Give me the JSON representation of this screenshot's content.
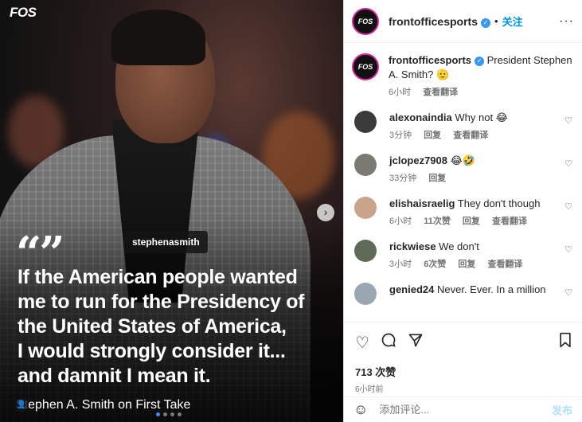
{
  "media": {
    "logo": "FOS",
    "quote_marks": "“”",
    "quote_lines": [
      "If the American people wanted",
      "me to run for the Presidency of",
      "the United States of America,",
      "I would strongly consider it...",
      "and damnit I mean it."
    ],
    "attribution": "Stephen A. Smith on First Take",
    "tagged_user": "stephenasmith",
    "carousel_dots": 4,
    "active_dot": 0
  },
  "post": {
    "author": "frontofficesports",
    "avatar_text": "FOS",
    "follow_label": "关注",
    "separator": "•",
    "caption_text": "President Stephen A. Smith? 🫡",
    "caption_time": "6小时",
    "translate_label": "查看翻译",
    "likes": "713 次赞",
    "posted_time": "6小时前",
    "comment_placeholder": "添加评论...",
    "post_button": "发布"
  },
  "comments": [
    {
      "user": "alexonaindia",
      "text": "Why not 😂",
      "time": "3分钟",
      "likes": "",
      "reply": "回复",
      "translate": "查看翻译",
      "avatar_color": "#3b3b3b"
    },
    {
      "user": "jclopez7908",
      "text": "😂🤣",
      "time": "33分钟",
      "likes": "",
      "reply": "回复",
      "translate": "",
      "avatar_color": "#7a7a72"
    },
    {
      "user": "elishaisraelig",
      "text": "They don't though",
      "time": "6小时",
      "likes": "11次赞",
      "reply": "回复",
      "translate": "查看翻译",
      "avatar_color": "#c9a48a"
    },
    {
      "user": "rickwiese",
      "text": "We don't",
      "time": "3小时",
      "likes": "6次赞",
      "reply": "回复",
      "translate": "查看翻译",
      "avatar_color": "#5d6b57"
    },
    {
      "user": "genied24",
      "text": "Never. Ever. In a million",
      "time": "",
      "likes": "",
      "reply": "",
      "translate": "",
      "avatar_color": "#9aa7b0"
    }
  ],
  "colors": {
    "accent_blue": "#0095f6",
    "verified": "#3897f0",
    "ring": "#d6249f"
  }
}
